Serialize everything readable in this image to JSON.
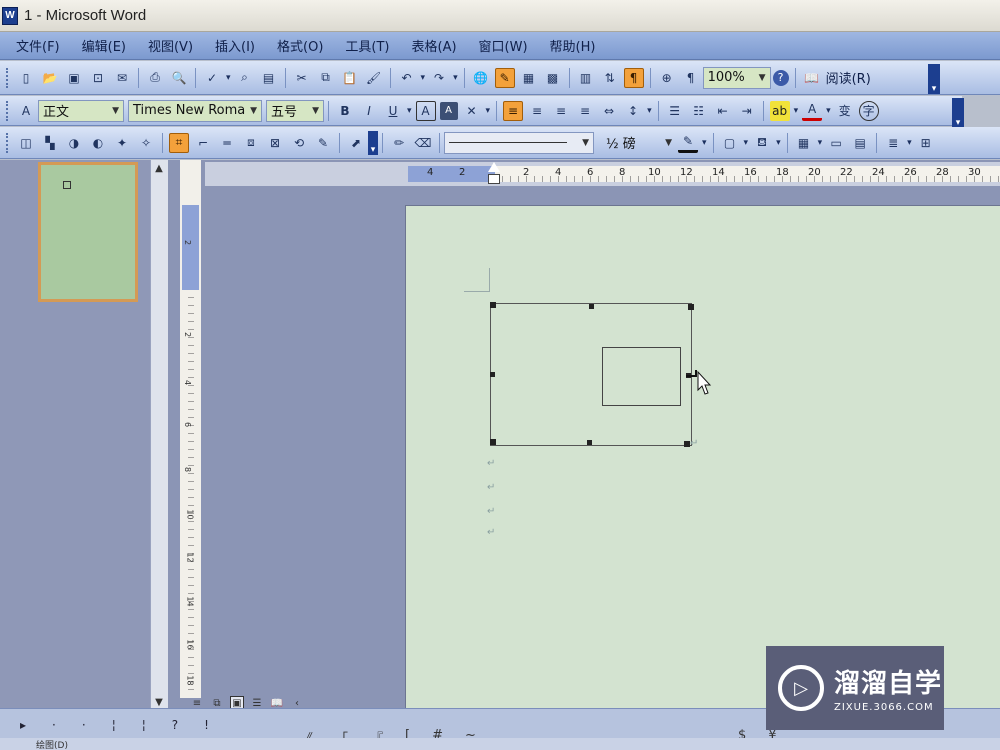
{
  "window": {
    "title": "1 - Microsoft Word",
    "app_icon": "W"
  },
  "menubar": {
    "items": [
      "文件(F)",
      "编辑(E)",
      "视图(V)",
      "插入(I)",
      "格式(O)",
      "工具(T)",
      "表格(A)",
      "窗口(W)",
      "帮助(H)"
    ]
  },
  "standard_toolbar": {
    "zoom": "100%",
    "help_glyph": "?",
    "reading_label": "阅读(R)",
    "icons": [
      "new-icon",
      "open-icon",
      "save-icon",
      "permission-icon",
      "email-icon",
      "print-icon",
      "print-preview-icon",
      "spelling-icon",
      "research-icon",
      "cut-icon",
      "copy-icon",
      "paste-icon",
      "format-painter-icon",
      "undo-icon",
      "redo-icon",
      "hyperlink-icon",
      "drawing-toggle-icon",
      "table-icon",
      "excel-icon",
      "columns-icon",
      "doc-map-icon",
      "show-hide-icon",
      "zoom-icon"
    ]
  },
  "format_toolbar": {
    "style": "正文",
    "font": "Times New Roma",
    "size": "五号",
    "bold": "B",
    "italic": "I",
    "underline": "U",
    "char_border": "A",
    "char_shading": "A",
    "font_color": "A",
    "phonetic": "变",
    "enclose": "字"
  },
  "drawing_canvas_toolbar": {
    "line_weight": "½ 磅"
  },
  "hruler": {
    "numbers": [
      "4",
      "2",
      "2",
      "4",
      "6",
      "8",
      "10",
      "12",
      "14",
      "16",
      "18",
      "20",
      "22",
      "24",
      "26",
      "28",
      "30"
    ]
  },
  "vruler": {
    "numbers": [
      "2",
      "2",
      "4",
      "6",
      "8",
      "10",
      "12",
      "14",
      "16",
      "18"
    ]
  },
  "document": {
    "paragraph_mark": "↵"
  },
  "watermark": {
    "name": "溜溜自学",
    "url": "ZIXUE.3066.COM"
  },
  "statusbar": {
    "left_text": "绘图(D)",
    "symbols": [
      "《",
      "「",
      "『",
      "[",
      "#",
      "~",
      "$",
      "¥"
    ]
  }
}
